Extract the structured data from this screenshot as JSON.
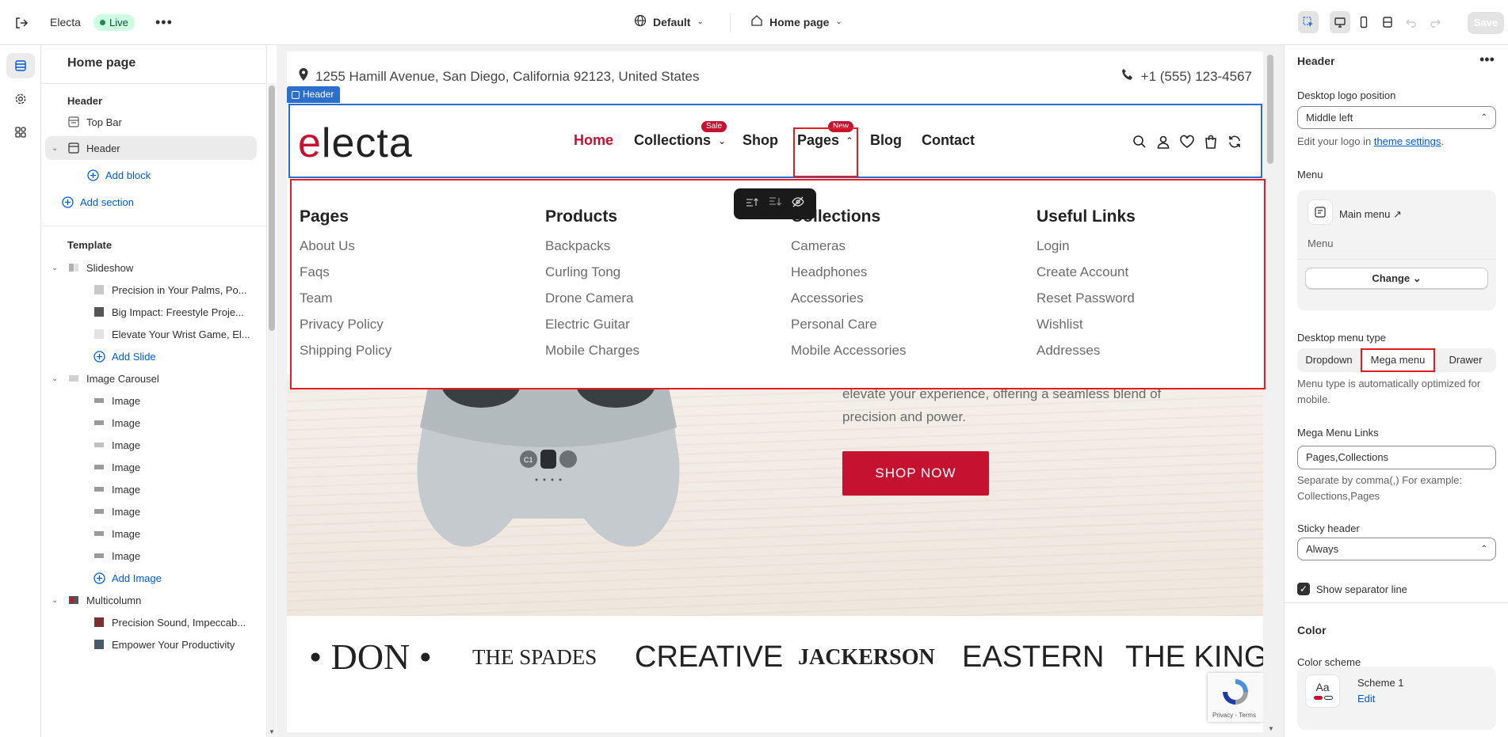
{
  "topbar": {
    "store_name": "Electa",
    "status": "Live",
    "theme_preset": "Default",
    "page_selector": "Home page",
    "save_label": "Save"
  },
  "left_panel": {
    "title": "Home page",
    "header_group": "Header",
    "header_items": [
      {
        "label": "Top Bar"
      },
      {
        "label": "Header"
      }
    ],
    "add_block": "Add block",
    "add_section": "Add section",
    "template_group": "Template",
    "slideshow": {
      "label": "Slideshow",
      "items": [
        "Precision in Your Palms, Po...",
        "Big Impact: Freestyle Proje...",
        "Elevate Your Wrist Game, El..."
      ],
      "add": "Add Slide"
    },
    "carousel": {
      "label": "Image Carousel",
      "items": [
        "Image",
        "Image",
        "Image",
        "Image",
        "Image",
        "Image",
        "Image",
        "Image"
      ],
      "add": "Add Image"
    },
    "multicolumn": {
      "label": "Multicolumn",
      "items": [
        "Precision Sound, Impeccab...",
        "Empower Your Productivity"
      ]
    }
  },
  "site": {
    "address": "1255 Hamill Avenue, San Diego, California 92123, United States",
    "phone": "+1 (555) 123-4567",
    "header_tag": "Header",
    "logo_first": "e",
    "logo_rest": "lecta",
    "nav": [
      {
        "label": "Home"
      },
      {
        "label": "Collections",
        "badge": "Sale"
      },
      {
        "label": "Shop"
      },
      {
        "label": "Pages",
        "badge": "New"
      },
      {
        "label": "Blog"
      },
      {
        "label": "Contact"
      }
    ],
    "mega_menu": [
      {
        "title": "Pages",
        "links": [
          "About Us",
          "Faqs",
          "Team",
          "Privacy Policy",
          "Shipping Policy"
        ]
      },
      {
        "title": "Products",
        "links": [
          "Backpacks",
          "Curling Tong",
          "Drone Camera",
          "Electric Guitar",
          "Mobile Charges"
        ]
      },
      {
        "title": "Collections",
        "links": [
          "Cameras",
          "Headphones",
          "Accessories",
          "Personal Care",
          "Mobile Accessories"
        ]
      },
      {
        "title": "Useful Links",
        "links": [
          "Login",
          "Create Account",
          "Reset Password",
          "Wishlist",
          "Addresses"
        ]
      }
    ],
    "hero_text_line1": "elevate your experience, offering a seamless blend of",
    "hero_text_line2": "precision and power.",
    "shop_now": "SHOP NOW",
    "brands": [
      "• DON •",
      "THE SPADES",
      "CREATIVE",
      "JACKERSON",
      "EASTERN",
      "THE KING"
    ],
    "recaptcha": "Privacy - Terms"
  },
  "right_panel": {
    "title": "Header",
    "logo_position_label": "Desktop logo position",
    "logo_position_value": "Middle left",
    "logo_help_prefix": "Edit your logo in ",
    "logo_help_link": "theme settings",
    "logo_help_suffix": ".",
    "menu_label": "Menu",
    "menu_name": "Main menu",
    "menu_sub": "Menu",
    "change": "Change",
    "menu_type_label": "Desktop menu type",
    "menu_types": [
      "Dropdown",
      "Mega menu",
      "Drawer"
    ],
    "menu_type_selected": "Mega menu",
    "menu_type_help": "Menu type is automatically optimized for mobile.",
    "mega_links_label": "Mega Menu Links",
    "mega_links_value": "Pages,Collections",
    "mega_links_help": "Separate by comma(,) For example: Collections,Pages",
    "sticky_label": "Sticky header",
    "sticky_value": "Always",
    "separator_label": "Show separator line",
    "separator_checked": true,
    "color_heading": "Color",
    "color_scheme_label": "Color scheme",
    "scheme_name": "Scheme 1",
    "scheme_edit": "Edit",
    "scheme_preview": "Aa"
  },
  "colors": {
    "accent": "#c41230",
    "selection_blue": "#2c6ecb",
    "highlight_red": "#e51c23",
    "link_blue": "#005bd3"
  }
}
